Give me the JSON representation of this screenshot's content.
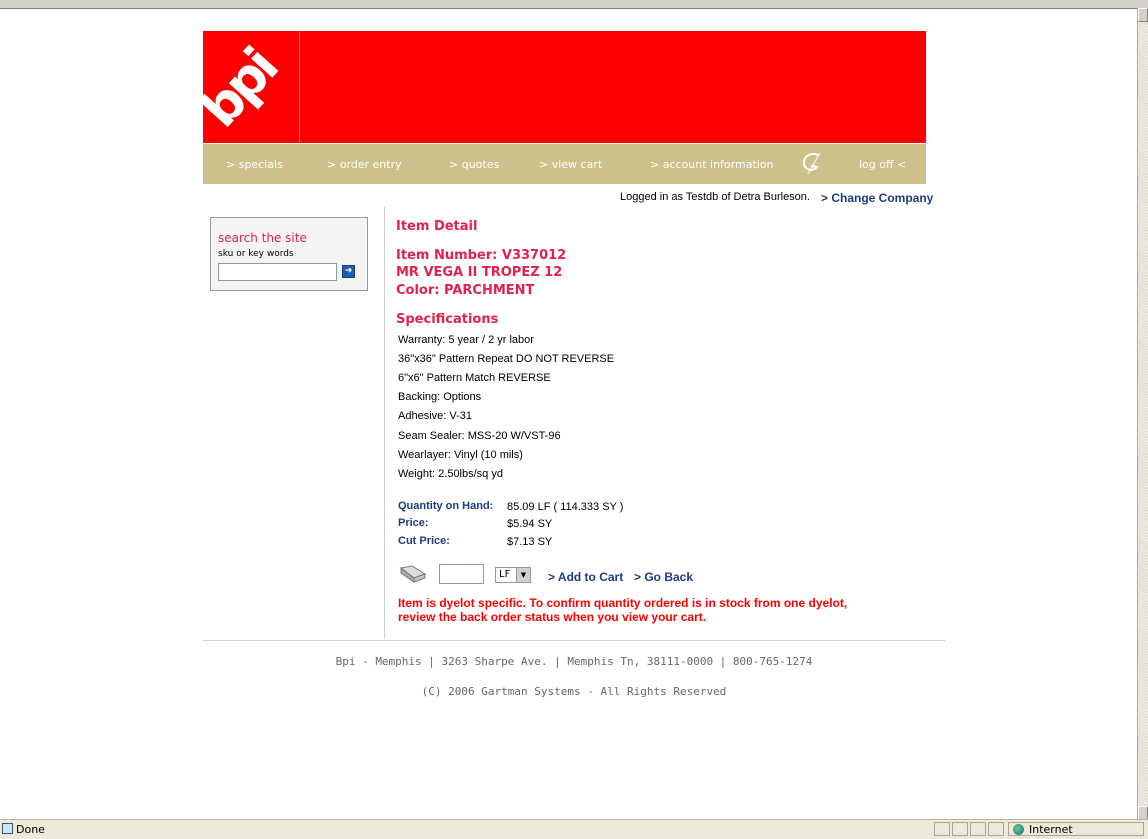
{
  "nav": {
    "specials": "> specials",
    "order_entry": "> order entry",
    "quotes": "> quotes",
    "view_cart": "> view cart",
    "account_information": "> account information",
    "log_off": "log off <"
  },
  "logo_text": "bpi",
  "session": {
    "logged_in": "Logged in as Testdb of Detra Burleson.",
    "change_company": "> Change Company"
  },
  "search": {
    "title": "search the site",
    "subtitle": "sku or key words",
    "value": ""
  },
  "item": {
    "heading": "Item Detail",
    "number_line": "Item Number:  V337012",
    "name_line": "MR VEGA II TROPEZ 12",
    "color_line": "Color: PARCHMENT"
  },
  "specs": {
    "heading": "Specifications",
    "lines": [
      "Warranty: 5 year / 2 yr labor",
      "36\"x36\" Pattern Repeat DO NOT REVERSE",
      "6\"x6\" Pattern Match REVERSE",
      "Backing: Options",
      "Adhesive: V-31",
      "Seam Sealer: MSS-20 W/VST-96",
      "Wearlayer: Vinyl (10 mils)",
      "Weight: 2.50lbs/sq yd"
    ]
  },
  "stock": {
    "qoh_label": "Quantity on Hand:",
    "qoh_value": "85.09  LF  ( 114.333  SY )",
    "price_label": "Price:",
    "price_value": "$5.94  SY",
    "cut_label": "Cut Price:",
    "cut_value": "$7.13  SY"
  },
  "order": {
    "qty_value": "",
    "unit": "LF",
    "add_to_cart": "> Add to Cart",
    "go_back": "> Go Back"
  },
  "warning": "Item is dyelot specific. To confirm quantity ordered is in stock from one dyelot, review the back order status when you view your cart.",
  "footer": {
    "address": "Bpi - Memphis  |  3263 Sharpe Ave.  |  Memphis Tn, 38111-0000  |  800-765-1274",
    "copyright": "(C) 2006 Gartman Systems - All Rights Reserved"
  },
  "status": {
    "text": "Done",
    "zone": "Internet"
  },
  "colors": {
    "banner": "#ff0000",
    "nav": "#cdc08a",
    "accent_pink": "#e4214c",
    "link_blue": "#1f3b80",
    "warning": "#ff0000"
  }
}
